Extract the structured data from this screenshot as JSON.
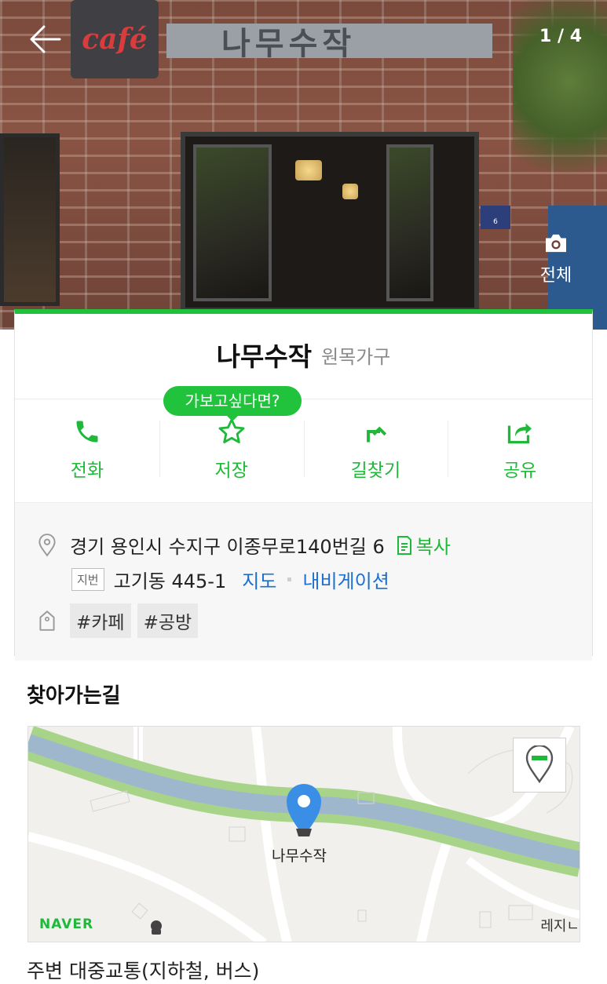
{
  "header": {
    "back_icon": "arrow-left-icon",
    "counter": "1 / 4",
    "view_all_label": "전체",
    "view_all_icon": "camera-icon",
    "photo_signs": {
      "cafe": "café",
      "name": "나무수작",
      "plate": "6"
    }
  },
  "place": {
    "name": "나무수작",
    "category": "원목가구",
    "tooltip": "가보고싶다면?"
  },
  "actions": [
    {
      "label": "전화",
      "icon": "phone-icon"
    },
    {
      "label": "저장",
      "icon": "star-icon"
    },
    {
      "label": "길찾기",
      "icon": "directions-icon"
    },
    {
      "label": "공유",
      "icon": "share-icon"
    }
  ],
  "info": {
    "address": "경기 용인시 수지구 이종무로140번길 6",
    "copy_label": "복사",
    "jibun_tag": "지번",
    "jibun": "고기동 445-1",
    "map_link": "지도",
    "navigation_link": "내비게이션",
    "tags": [
      "#카페",
      "#공방"
    ]
  },
  "directions": {
    "title": "찾아가는길",
    "map_place_label": "나무수작",
    "map_brand": "NAVER",
    "map_edge_label": "레지ㄴ",
    "transit_title": "주변 대중교통(지하철, 버스)"
  },
  "colors": {
    "accent": "#1fb93a",
    "link": "#1a6fd1",
    "pin": "#3a8ee6"
  }
}
